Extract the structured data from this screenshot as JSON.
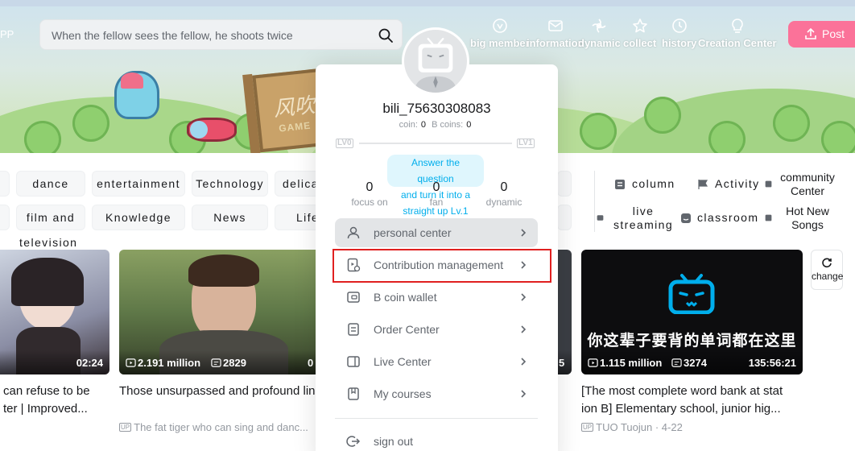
{
  "header": {
    "app_text": "PP",
    "search": {
      "placeholder": "When the fellow sees the fellow, he shoots twice"
    },
    "banner_sign": {
      "text": "风吹",
      "sub": "GAME"
    },
    "nav": [
      {
        "label": "big member",
        "icon": "big-member-icon"
      },
      {
        "label": "information",
        "icon": "mail-icon"
      },
      {
        "label": "dynamic",
        "icon": "dynamic-icon"
      },
      {
        "label": "collect",
        "icon": "star-icon"
      },
      {
        "label": "history",
        "icon": "clock-icon"
      },
      {
        "label": "Creation Center",
        "icon": "lightbulb-icon"
      }
    ],
    "post_label": "Post"
  },
  "categories": {
    "row1": [
      "dance",
      "entertainment",
      "Technology",
      "delica"
    ],
    "row2": [
      "film and",
      "Knowledge",
      "News",
      "Life"
    ],
    "tv_label": "television",
    "side": {
      "column": "column",
      "activity": "Activity",
      "community": "community Center",
      "live": "live streaming",
      "classroom": "classroom",
      "hot_songs": "Hot New Songs"
    }
  },
  "cards": [
    {
      "duration": "02:24",
      "title": "can refuse to be ter | Improved...",
      "meta": ""
    },
    {
      "views": "2.191 million",
      "comments": "2829",
      "duration": "0",
      "title": "Those unsurpassed and profound lin es in the movie.",
      "up": "UP",
      "author": "The fat tiger who can sing and danc...",
      "date": ""
    },
    {
      "duration_partial": "5"
    },
    {
      "views": "1.115 million",
      "comments": "3274",
      "duration": "135:56:21",
      "title": "[The most complete word bank at stat ion B] Elementary school, junior hig...",
      "up": "UP",
      "author": "TUO Tuojun",
      "date": "4-22",
      "banner_text": "你这辈子要背的单词都在这里"
    }
  ],
  "change_label": "change",
  "dropdown": {
    "username": "bili_75630308083",
    "coin_label": "coin:",
    "coin_value": "0",
    "bcoin_label": "B coins:",
    "bcoin_value": "0",
    "level_left": "LV0",
    "level_right": "LV1",
    "task_lines": [
      "Answer the question",
      "and turn it into a",
      "straight up Lv.1"
    ],
    "stats": [
      {
        "value": "0",
        "label": "focus on"
      },
      {
        "value": "0",
        "label": "fan"
      },
      {
        "value": "0",
        "label": "dynamic"
      }
    ],
    "menu": [
      {
        "label": "personal center",
        "icon": "user-icon"
      },
      {
        "label": "Contribution management",
        "icon": "contribution-icon"
      },
      {
        "label": "B coin wallet",
        "icon": "wallet-icon"
      },
      {
        "label": "Order Center",
        "icon": "order-icon"
      },
      {
        "label": "Live Center",
        "icon": "live-icon"
      },
      {
        "label": "My courses",
        "icon": "courses-icon"
      }
    ],
    "signout": "sign out"
  },
  "colors": {
    "accent": "#fb7299",
    "blue": "#00aeec",
    "highlight": "#e02020"
  }
}
